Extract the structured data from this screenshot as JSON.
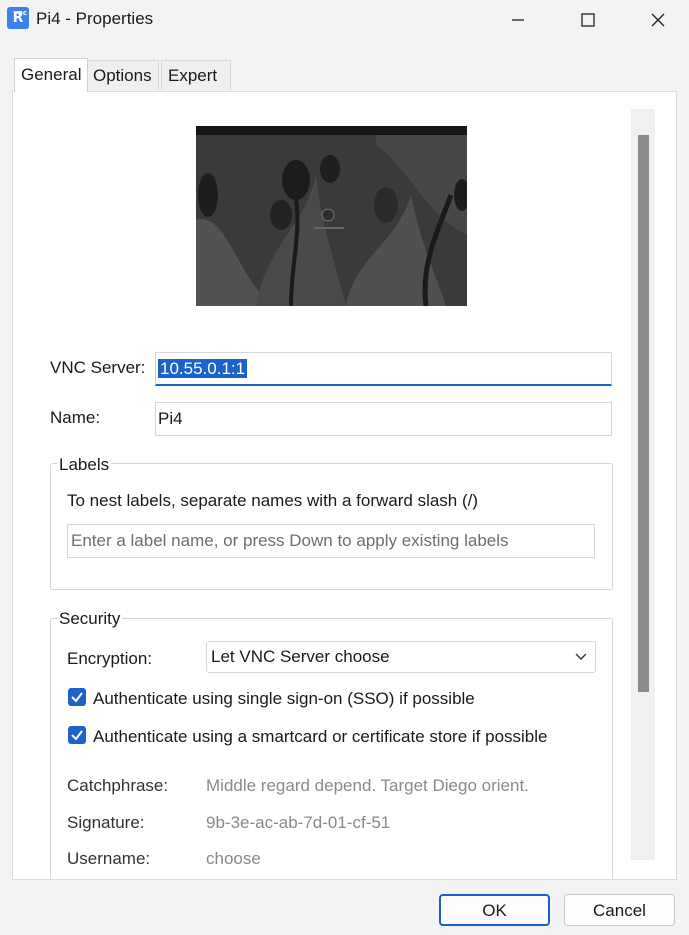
{
  "window": {
    "title": "Pi4 - Properties",
    "app_icon_letter": "R",
    "app_icon_small": "vnc"
  },
  "tabs": [
    {
      "label": "General",
      "active": true
    },
    {
      "label": "Options",
      "active": false
    },
    {
      "label": "Expert",
      "active": false
    }
  ],
  "general": {
    "vnc_server_label": "VNC Server:",
    "vnc_server_value": "10.55.0.1:1",
    "name_label": "Name:",
    "name_value": "Pi4",
    "labels": {
      "title": "Labels",
      "hint": "To nest labels, separate names with a forward slash (/)",
      "input_placeholder": "Enter a label name, or press Down to apply existing labels"
    },
    "security": {
      "title": "Security",
      "encryption_label": "Encryption:",
      "encryption_value": "Let VNC Server choose",
      "sso_label": "Authenticate using single sign-on (SSO) if possible",
      "sso_checked": true,
      "smartcard_label": "Authenticate using a smartcard or certificate store if possible",
      "smartcard_checked": true,
      "catchphrase_label": "Catchphrase:",
      "catchphrase_value": "Middle regard depend. Target Diego orient.",
      "signature_label": "Signature:",
      "signature_value": "9b-3e-ac-ab-7d-01-cf-51",
      "username_label": "Username:",
      "username_value": "choose"
    }
  },
  "footer": {
    "ok_label": "OK",
    "cancel_label": "Cancel"
  },
  "colors": {
    "accent": "#1a64c7",
    "window_bg": "#f3f3f3",
    "panel_bg": "#ffffff"
  },
  "icons": {
    "minimize": "minimize-icon",
    "maximize": "maximize-icon",
    "close": "close-icon",
    "dropdown": "chevron-down-icon",
    "check": "checkmark-icon"
  }
}
